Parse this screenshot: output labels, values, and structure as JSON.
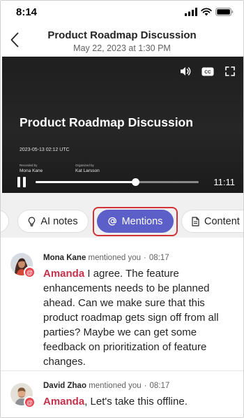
{
  "status_bar": {
    "time": "8:14"
  },
  "header": {
    "title": "Product Roadmap Discussion",
    "subtitle": "May 22, 2023 at 1:30 PM"
  },
  "video": {
    "title": "Product Roadmap Discussion",
    "date": "2023-05-13 02:12 UTC",
    "recorded_label": "Recorded by",
    "recorded_by": "Mona Kane",
    "organized_label": "Organized by",
    "organized_by": "Kat Larsson",
    "duration": "11:11",
    "progress": 0.61,
    "controls": [
      "volume-icon",
      "captions-icon",
      "fullscreen-icon"
    ],
    "captions_label": "CC"
  },
  "tabs": [
    {
      "label": "AI notes",
      "icon": "lightbulb-icon"
    },
    {
      "label": "Mentions",
      "icon": "at-icon",
      "selected": true
    },
    {
      "label": "Content",
      "icon": "document-icon"
    }
  ],
  "mentions": [
    {
      "name": "Mona Kane",
      "action": "mentioned you",
      "time": "08:17",
      "tag": "Amanda",
      "text": " I agree. The feature enhancements needs to be planned ahead. Can we make sure that this product roadmap gets sign off from all parties? Maybe we can get some feedback on prioritization of feature changes."
    },
    {
      "name": "David Zhao",
      "action": "mentioned you",
      "time": "08:17",
      "tag": "Amanda",
      "text": ", Let's take this offline."
    }
  ],
  "colors": {
    "accent": "#5b5fc7",
    "highlight": "#d13438",
    "mention_tag": "#c4314b",
    "badge": "#e8444e"
  }
}
